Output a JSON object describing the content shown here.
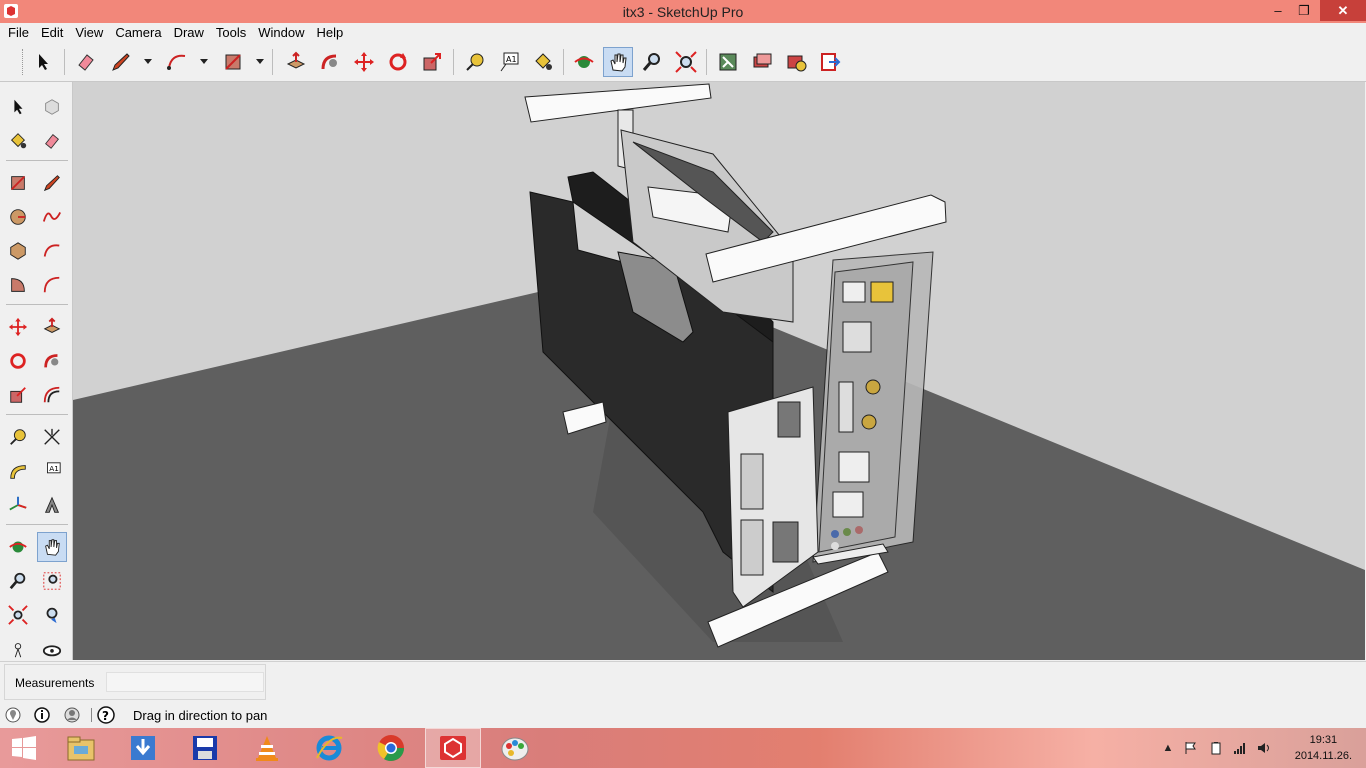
{
  "window": {
    "title": "itx3 - SketchUp Pro",
    "minimize": "–",
    "maximize": "❐",
    "close": "✕"
  },
  "menu": [
    "File",
    "Edit",
    "View",
    "Camera",
    "Draw",
    "Tools",
    "Window",
    "Help"
  ],
  "measurements": {
    "label": "Measurements",
    "value": ""
  },
  "status": {
    "text": "Drag in direction to pan"
  },
  "toolbar": {
    "icons": [
      "select-icon",
      "eraser-icon",
      "pencil-icon",
      "arc-icon",
      "rectangle-icon",
      "push-pull-icon",
      "follow-me-icon",
      "move-icon",
      "rotate-icon",
      "scale-icon",
      "tape-measure-icon",
      "text-icon",
      "paint-bucket-icon",
      "orbit-icon",
      "pan-icon",
      "zoom-icon",
      "zoom-extents-icon",
      "warehouse-icon",
      "share-model-icon",
      "extension-warehouse-icon",
      "send-to-layout-icon"
    ],
    "active_tool": "pan-icon"
  },
  "taskbar": {
    "apps": [
      "file-explorer-icon",
      "downloads-icon",
      "save-app-icon",
      "vlc-icon",
      "internet-explorer-icon",
      "chrome-icon",
      "sketchup-icon",
      "paint-icon"
    ],
    "active_app": "sketchup-icon",
    "clock_time": "19:31",
    "clock_date": "2014.11.26."
  },
  "colors": {
    "titlebar": "#f2877a",
    "close_button": "#c7403a",
    "active_tool": "#c9dcf3",
    "sky": "#d1d1d1",
    "ground": "#5f5f5f"
  }
}
